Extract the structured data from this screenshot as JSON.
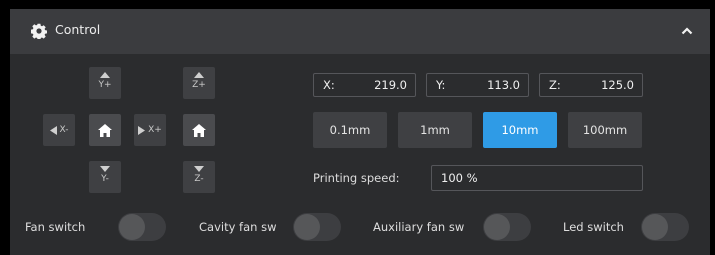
{
  "header": {
    "title": "Control",
    "icon": "gear-icon",
    "collapse_icon": "chevron-up-icon"
  },
  "jog": {
    "y_plus": "Y+",
    "y_minus": "Y-",
    "x_minus": "X-",
    "x_plus": "X+",
    "z_plus": "Z+",
    "z_minus": "Z-",
    "home_icon": "home-icon"
  },
  "coords": [
    {
      "label": "X:",
      "value": "219.0"
    },
    {
      "label": "Y:",
      "value": "113.0"
    },
    {
      "label": "Z:",
      "value": "125.0"
    }
  ],
  "steps": [
    {
      "label": "0.1mm",
      "active": false
    },
    {
      "label": "1mm",
      "active": false
    },
    {
      "label": "10mm",
      "active": true
    },
    {
      "label": "100mm",
      "active": false
    }
  ],
  "speed": {
    "label": "Printing speed:",
    "value": "100 %"
  },
  "switches": [
    {
      "label": "Fan switch",
      "on": false
    },
    {
      "label": "Cavity fan sw",
      "on": false
    },
    {
      "label": "Auxiliary fan sw",
      "on": false
    },
    {
      "label": "Led switch",
      "on": false
    }
  ],
  "colors": {
    "accent": "#2f9be6",
    "panel": "#2b2c2e",
    "header": "#3b3c3f"
  }
}
